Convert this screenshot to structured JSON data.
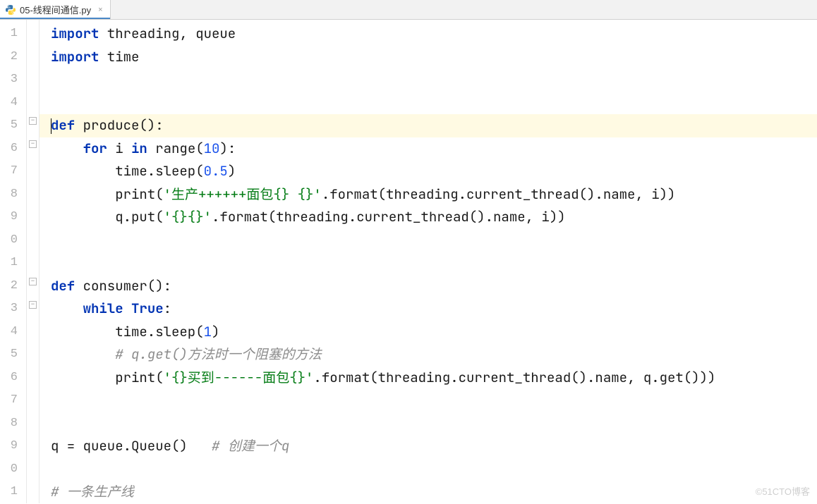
{
  "tab": {
    "filename": "05-线程间通信.py",
    "close_icon": "×"
  },
  "gutter": {
    "lines": [
      "1",
      "2",
      "3",
      "4",
      "5",
      "6",
      "7",
      "8",
      "9",
      "0",
      "1",
      "2",
      "3",
      "4",
      "5",
      "6",
      "7",
      "8",
      "9",
      "0",
      "1"
    ]
  },
  "code": {
    "l1": {
      "kw1": "import",
      "rest": " threading, queue"
    },
    "l2": {
      "kw1": "import",
      "rest": " time"
    },
    "l5": {
      "kw1": "def",
      "name": " produce():"
    },
    "l6": {
      "indent": "    ",
      "kw1": "for",
      "mid1": " i ",
      "kw2": "in",
      "mid2": " range(",
      "num": "10",
      "rest": "):"
    },
    "l7": {
      "indent": "        ",
      "pre": "time.sleep(",
      "num": "0.5",
      "post": ")"
    },
    "l8": {
      "indent": "        ",
      "pre": "print(",
      "str": "'生产++++++面包{} {}'",
      "post": ".format(threading.current_thread().name, i))"
    },
    "l9": {
      "indent": "        ",
      "pre": "q.put(",
      "str": "'{}{}'",
      "post": ".format(threading.current_thread().name, i))"
    },
    "l12": {
      "kw1": "def",
      "name": " consumer():"
    },
    "l13": {
      "indent": "    ",
      "kw1": "while",
      "mid": " ",
      "kw2": "True",
      "rest": ":"
    },
    "l14": {
      "indent": "        ",
      "pre": "time.sleep(",
      "num": "1",
      "post": ")"
    },
    "l15": {
      "indent": "        ",
      "comment": "# q.get()方法时一个阻塞的方法"
    },
    "l16": {
      "indent": "        ",
      "pre": "print(",
      "str": "'{}买到------面包{}'",
      "post": ".format(threading.current_thread().name, q.get()))"
    },
    "l19": {
      "pre": "q = queue.Queue()   ",
      "comment": "# 创建一个q"
    },
    "l21": {
      "comment": "# 一条生产线"
    }
  },
  "watermark": "©51CTO博客"
}
